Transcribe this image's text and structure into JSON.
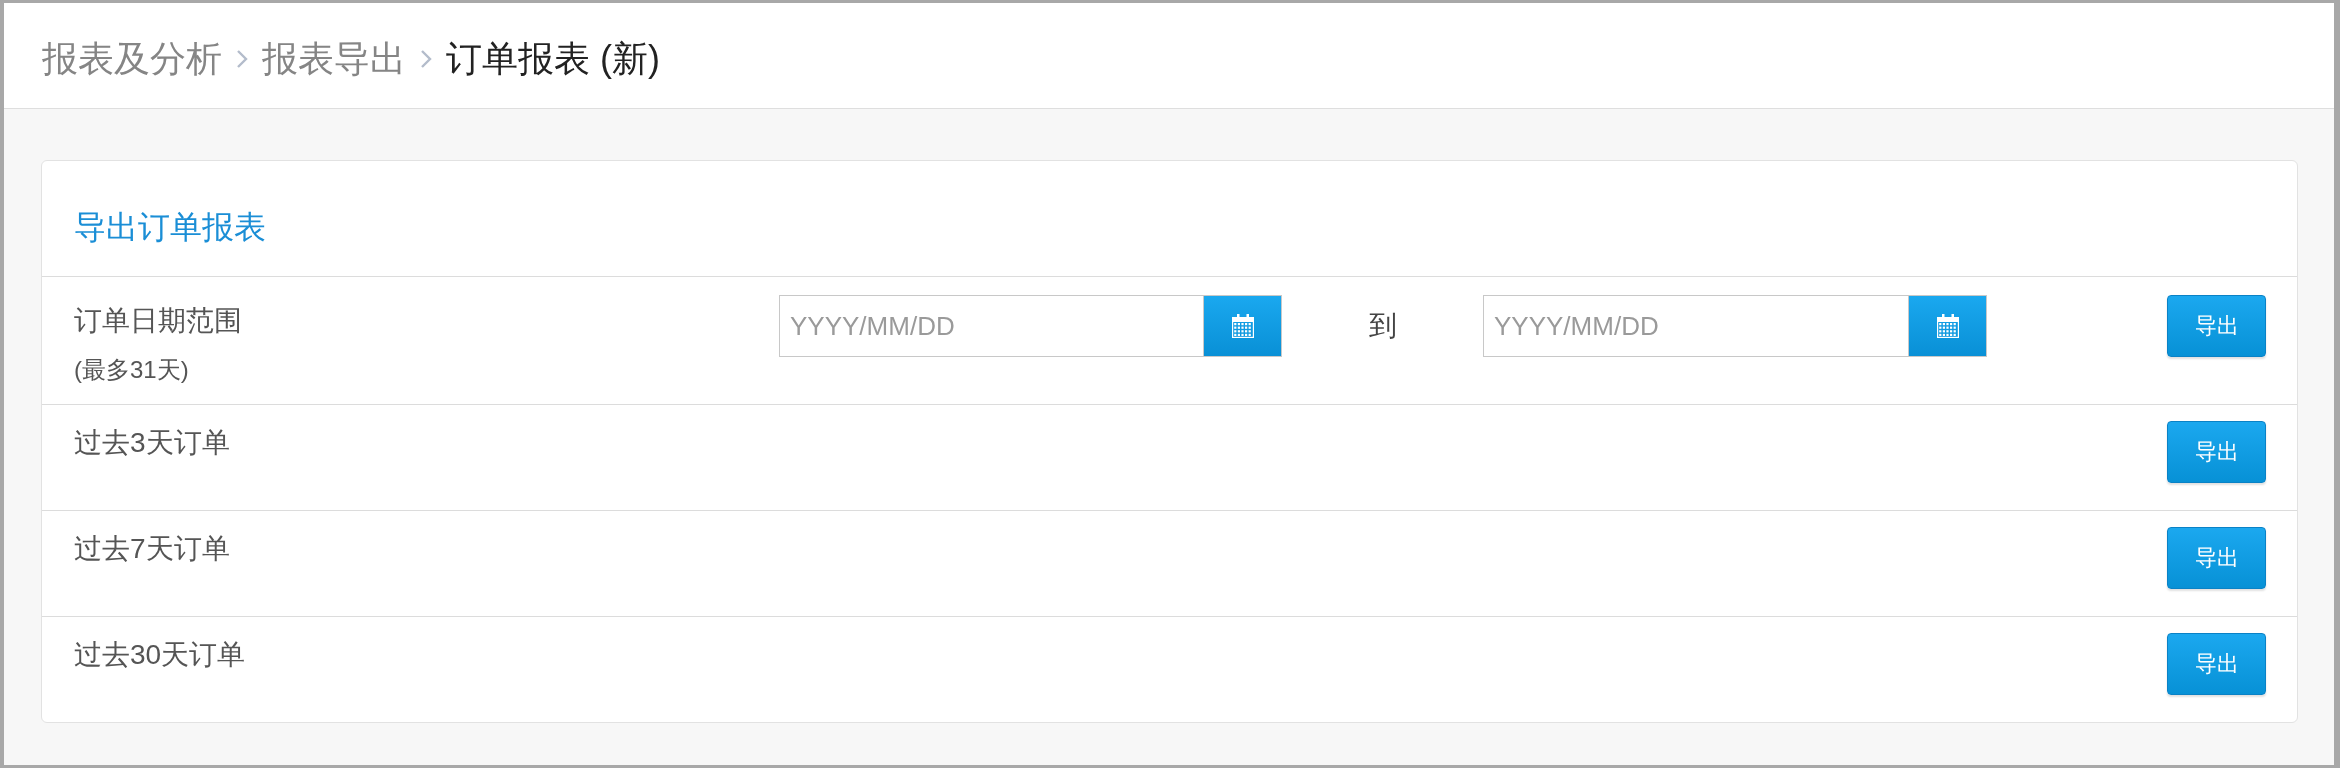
{
  "breadcrumb": [
    {
      "label": "报表及分析",
      "current": false
    },
    {
      "label": "报表导出",
      "current": false
    },
    {
      "label": "订单报表 (新)",
      "current": true
    }
  ],
  "card": {
    "title": "导出订单报表"
  },
  "rows": [
    {
      "kind": "date_range",
      "label": "订单日期范围",
      "note": "(最多31天)",
      "start": {
        "placeholder": "YYYY/MM/DD"
      },
      "separator": "到",
      "end": {
        "placeholder": "YYYY/MM/DD"
      },
      "button": "导出"
    },
    {
      "kind": "preset",
      "label": "过去3天订单",
      "button": "导出"
    },
    {
      "kind": "preset",
      "label": "过去7天订单",
      "button": "导出"
    },
    {
      "kind": "preset",
      "label": "过去30天订单",
      "button": "导出"
    }
  ]
}
